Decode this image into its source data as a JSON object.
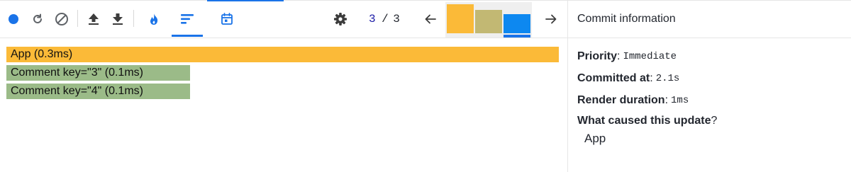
{
  "toolbar": {
    "icons": [
      "record-icon",
      "reload-icon",
      "clear-icon",
      "upload-icon",
      "download-icon",
      "flamegraph-icon",
      "ranked-icon",
      "timeline-icon",
      "settings-icon",
      "prev-arrow-icon",
      "next-arrow-icon"
    ]
  },
  "commit": {
    "current": "3",
    "separator": "/",
    "total": "3",
    "bars": [
      {
        "color": "#fbba38",
        "level": 0.93
      },
      {
        "color": "#c2b873",
        "level": 0.75
      },
      {
        "color": "#0d88f0",
        "level": 0.61
      }
    ],
    "selected_index": 2
  },
  "flamegraph": {
    "rows": [
      {
        "label": "App (0.3ms)",
        "color": "#fbba38"
      },
      {
        "label": "Comment key=\"3\" (0.1ms)",
        "color": "#9bbb88"
      },
      {
        "label": "Comment key=\"4\" (0.1ms)",
        "color": "#9bbb88"
      }
    ]
  },
  "sidebar": {
    "title": "Commit information",
    "priority_label": "Priority",
    "priority_value": "Immediate",
    "committed_label": "Committed at",
    "committed_value": "2.1s",
    "duration_label": "Render duration",
    "duration_value": "1ms",
    "cause_label": "What caused this update",
    "cause_punct": "?",
    "cause_item": "App"
  },
  "colors": {
    "accent": "#1a73e8",
    "record": "#1a73e8",
    "icon": "#5f6368",
    "dark_icon": "#3c3c3c"
  }
}
